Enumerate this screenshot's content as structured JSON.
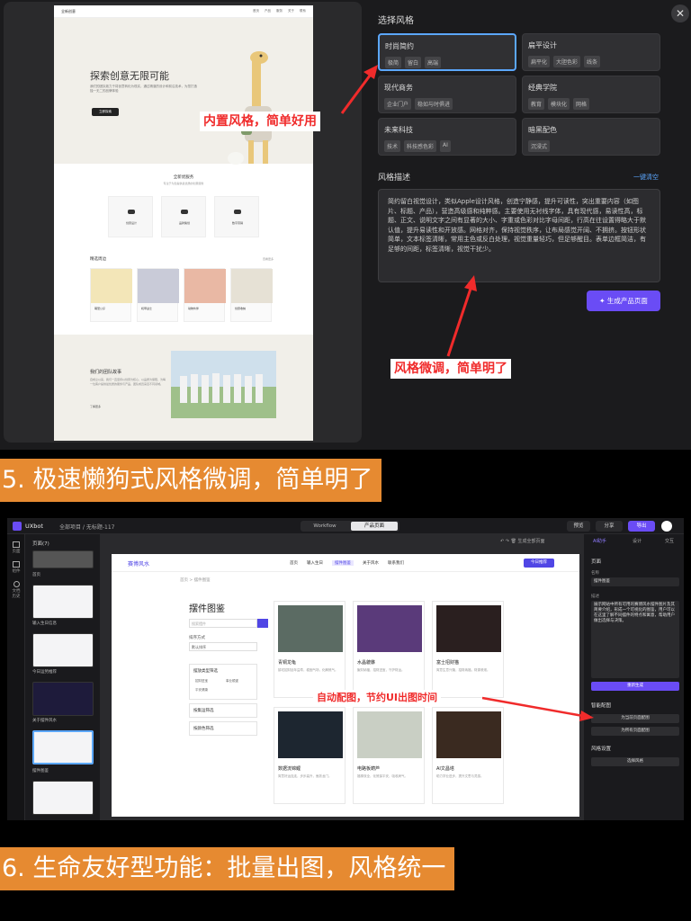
{
  "top": {
    "close_icon": "close-icon",
    "section_title": "选择风格",
    "styles": [
      {
        "name": "时尚简约",
        "tags": [
          "极简",
          "留白",
          "高端"
        ],
        "selected": true
      },
      {
        "name": "扁平设计",
        "tags": [
          "扁平化",
          "大胆色彩",
          "线条"
        ],
        "selected": false
      },
      {
        "name": "现代商务",
        "tags": [
          "企业门户",
          "稳如与时俱进"
        ],
        "selected": false
      },
      {
        "name": "经典学院",
        "tags": [
          "教育",
          "模块化",
          "网格"
        ],
        "selected": false
      },
      {
        "name": "未来科技",
        "tags": [
          "技术",
          "科技感色彩",
          "AI"
        ],
        "selected": false
      },
      {
        "name": "暗黑配色",
        "tags": [
          "沉浸式"
        ],
        "selected": false
      }
    ],
    "desc_title": "风格描述",
    "desc_clear": "一键清空",
    "desc_text": "简约留白视觉设计，类似Apple设计风格，创造宁静感，提升可读性，突出重要内容（如图片、标题、产品），营造高级感和纯粹感。主要使用无衬线字体，具有现代感，易读性高，标题、正文、说明文字之间有显著的大小、字重或色彩对比字母间距，行高在往设置得略大于默认值，提升易读性和开放感。网格对齐，保持视觉秩序，让布局感觉开阔、不拥挤。按钮形状简单，文本标签清晰，常用主色或反白处理，视觉重量轻巧，但足够醒目。表单边框简洁，有足够的间距，标签清晰，视觉干扰少。",
    "generate_label": "生成产品页面",
    "annotation_1": "内置风格，简单好用",
    "annotation_2": "风格微调，简单明了",
    "site": {
      "logo": "全新创意",
      "links": [
        "首页",
        "产品",
        "服务",
        "关于",
        "联系"
      ],
      "hero_title": "探索创意无限可能",
      "hero_text": "我们的团队致力于将创意转化为现实，通过精湛的设计和前沿技术，为您打造独一无二的品牌体验",
      "hero_cta": "立即探索",
      "services_title": "全新优服务",
      "services_sub": "专注于为您提供最优质的创意服务",
      "services": [
        "创意设计",
        "品牌策划",
        "数字营销"
      ],
      "products_title": "精选周边",
      "products_more": "查看更多",
      "products": [
        "萌宠公仔",
        "机甲战士",
        "动物伙伴",
        "创意收纳"
      ],
      "about_title": "我们的团队故事",
      "about_text": "自成立以来，我们一直坚持以创意为核心，以品质为保障，为每一位客户提供最优质的服务与产品，团队成员来自不同领域。",
      "about_more": "了解更多"
    }
  },
  "banner_5": "5. 极速懒狗式风格微调，简单明了",
  "app": {
    "logo_name": "UXbot",
    "breadcrumb": "全部项目 / 无标题-117",
    "tab_workflow": "Workflow",
    "tab_product": "产品页面",
    "btn_preview": "预览",
    "btn_share": "分享",
    "btn_export": "导出",
    "rail": [
      "页面",
      "组件",
      "文档历史"
    ],
    "pages_header": "页面(7)",
    "pages": [
      "首页",
      "输入生日信息",
      "今日运势推荐",
      "关于摆件风水",
      "摆件图鉴",
      ""
    ],
    "toolbar_hint": "生成全部页面",
    "site_logo": "赛博风水",
    "site_links": [
      "首页",
      "输入生日",
      "摆件图鉴",
      "关于风水",
      "联系我们"
    ],
    "site_cta": "今日推荐",
    "breadcrumb_site": "首页  >  摆件图鉴",
    "page_title": "摆件图鉴",
    "search_placeholder": "搜索摆件",
    "sort_label": "排序方式",
    "sort_value": "默认排序",
    "filters": [
      "摆放类型筛选",
      "按集运筛选",
      "按颜色筛选"
    ],
    "filter_opts": [
      "招财进宝",
      "事业顺遂",
      "平安健康"
    ],
    "cards": [
      {
        "title": "青铜龙龟",
        "desc": "镇宅招财延年益寿，稳固气场，化解煞气。"
      },
      {
        "title": "水晶貔貅",
        "desc": "聚财纳福，招财进宝，守护财运。"
      },
      {
        "title": "富士招财猫",
        "desc": "寓意生意兴隆，招财纳福，财源滚滚。"
      },
      {
        "title": "数据流锦鲤",
        "desc": "寓意好运连连，步步高升，鱼跃龙门。"
      },
      {
        "title": "电路板葫芦",
        "desc": "福禄双全，化煞保平安，吸收病气。"
      },
      {
        "title": "AI文昌塔",
        "desc": "助力学业进步，提升文思与灵感。"
      }
    ],
    "rp_tabs": [
      "AI助手",
      "设计",
      "交互"
    ],
    "rp_section": "页面",
    "rp_name_label": "名称",
    "rp_name_value": "摆件图鉴",
    "rp_desc_label": "描述",
    "rp_desc_value": "展示网站中所有可用的赛博风水摆件图片及其简要介绍，形成一个可视化的图鉴，用户可以在这里了解不同摆件的特点和寓意，帮助用户做出选择与决策。",
    "rp_regen": "重新生成",
    "rp_smart": "智能配图",
    "rp_btn_current": "为当前页面配图",
    "rp_btn_all": "为所有页面配图",
    "rp_style": "风格设置",
    "rp_style_btn": "选择风格",
    "annotation_3": "自动配图，节约UI出图时间"
  },
  "banner_6": "6. 生命友好型功能：批量出图，风格统一",
  "colors": {
    "accent": "#6a4cf5",
    "annotation_red": "#f02b2b",
    "banner": "#e68a31",
    "selected_border": "#5ba7ff"
  }
}
